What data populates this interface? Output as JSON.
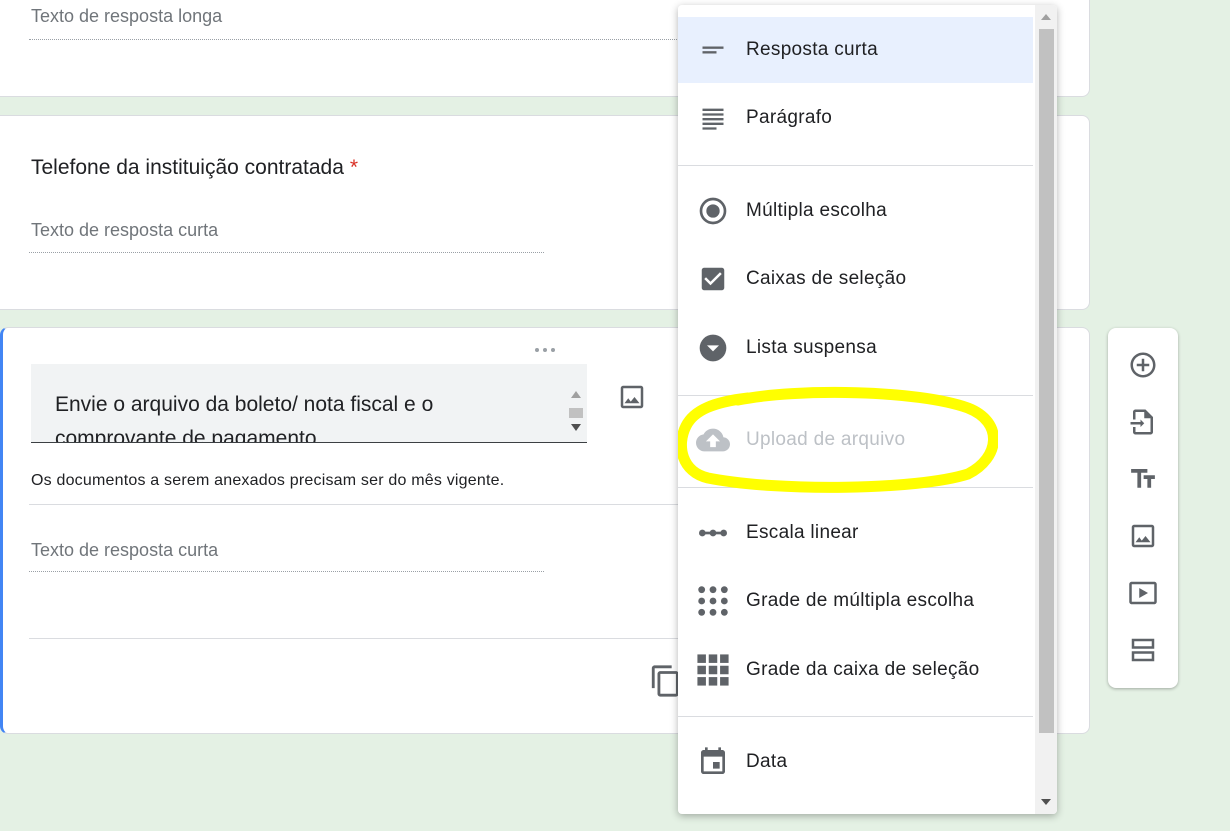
{
  "cards": {
    "long_answer": {
      "placeholder": "Texto de resposta longa"
    },
    "phone": {
      "title": "Telefone da instituição contratada",
      "required_mark": "*",
      "placeholder": "Texto de resposta curta"
    },
    "active": {
      "title": "Envie o arquivo da boleto/ nota fiscal e o comprovante de pagamento",
      "description": "Os documentos a serem anexados precisam ser do mês vigente.",
      "placeholder": "Texto de resposta curta"
    }
  },
  "menu": {
    "items": [
      {
        "label": "Resposta curta",
        "icon": "short-answer-icon",
        "selected": true
      },
      {
        "label": "Parágrafo",
        "icon": "paragraph-icon"
      },
      {
        "label": "Múltipla escolha",
        "icon": "radio-icon"
      },
      {
        "label": "Caixas de seleção",
        "icon": "checkbox-icon"
      },
      {
        "label": "Lista suspensa",
        "icon": "dropdown-icon"
      },
      {
        "label": "Upload de arquivo",
        "icon": "cloud-upload-icon",
        "disabled": true
      },
      {
        "label": "Escala linear",
        "icon": "linear-scale-icon"
      },
      {
        "label": "Grade de múltipla escolha",
        "icon": "grid-dots-icon"
      },
      {
        "label": "Grade da caixa de seleção",
        "icon": "grid-squares-icon"
      },
      {
        "label": "Data",
        "icon": "calendar-icon"
      }
    ]
  },
  "toolbar": {
    "items": [
      "add-question-icon",
      "import-questions-icon",
      "add-title-icon",
      "add-image-icon",
      "add-video-icon",
      "add-section-icon"
    ]
  },
  "colors": {
    "background": "#e4f1e4",
    "accent": "#4285f4",
    "selected_item": "#e8f0fe",
    "required": "#d93025",
    "highlight": "#ffff00"
  }
}
